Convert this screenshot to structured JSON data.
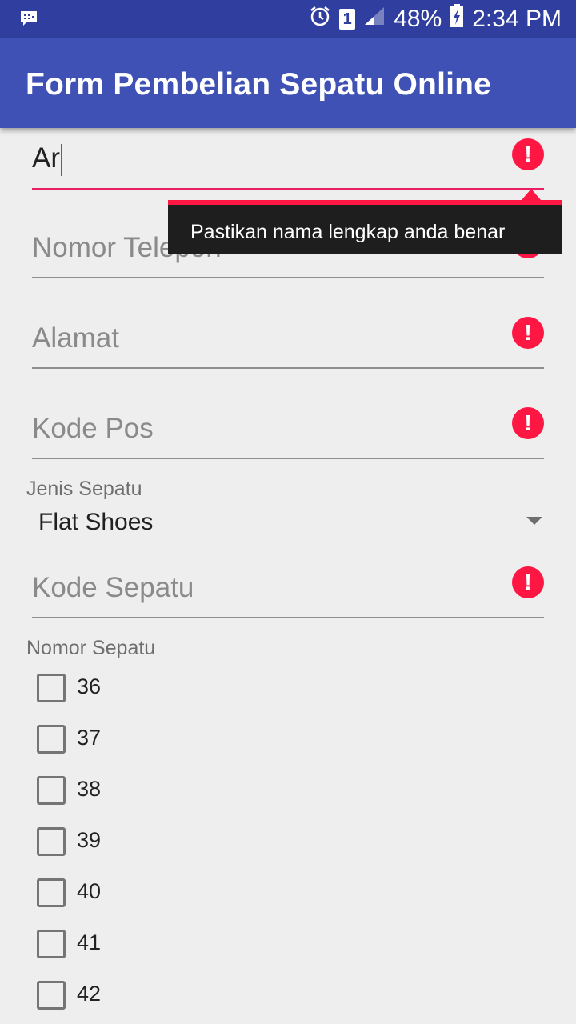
{
  "status_bar": {
    "notification_icon": "bbm-icon",
    "alarm_icon": "alarm-icon",
    "sim_label": "1",
    "signal_icon": "signal-icon",
    "battery_percent": "48%",
    "battery_icon": "battery-charging-icon",
    "time": "2:34 PM"
  },
  "app_bar": {
    "title": "Form Pembelian Sepatu Online"
  },
  "form": {
    "name_field": {
      "value": "Ar",
      "error_icon": "error-icon"
    },
    "error_popup": {
      "text": "Pastikan nama lengkap anda benar"
    },
    "phone_field": {
      "placeholder": "Nomor Telepon",
      "error_icon": "error-icon"
    },
    "address_field": {
      "placeholder": "Alamat",
      "error_icon": "error-icon"
    },
    "postal_field": {
      "placeholder": "Kode Pos",
      "error_icon": "error-icon"
    },
    "shoe_type": {
      "label": "Jenis Sepatu",
      "selected": "Flat Shoes"
    },
    "shoe_code_field": {
      "placeholder": "Kode Sepatu",
      "error_icon": "error-icon"
    },
    "shoe_size": {
      "label": "Nomor Sepatu",
      "options": [
        {
          "label": "36",
          "checked": false
        },
        {
          "label": "37",
          "checked": false
        },
        {
          "label": "38",
          "checked": false
        },
        {
          "label": "39",
          "checked": false
        },
        {
          "label": "40",
          "checked": false
        },
        {
          "label": "41",
          "checked": false
        },
        {
          "label": "42",
          "checked": false
        }
      ]
    }
  },
  "colors": {
    "status_bar": "#303f9f",
    "app_bar": "#3f51b5",
    "accent": "#e91e63",
    "error": "#ff1744"
  }
}
